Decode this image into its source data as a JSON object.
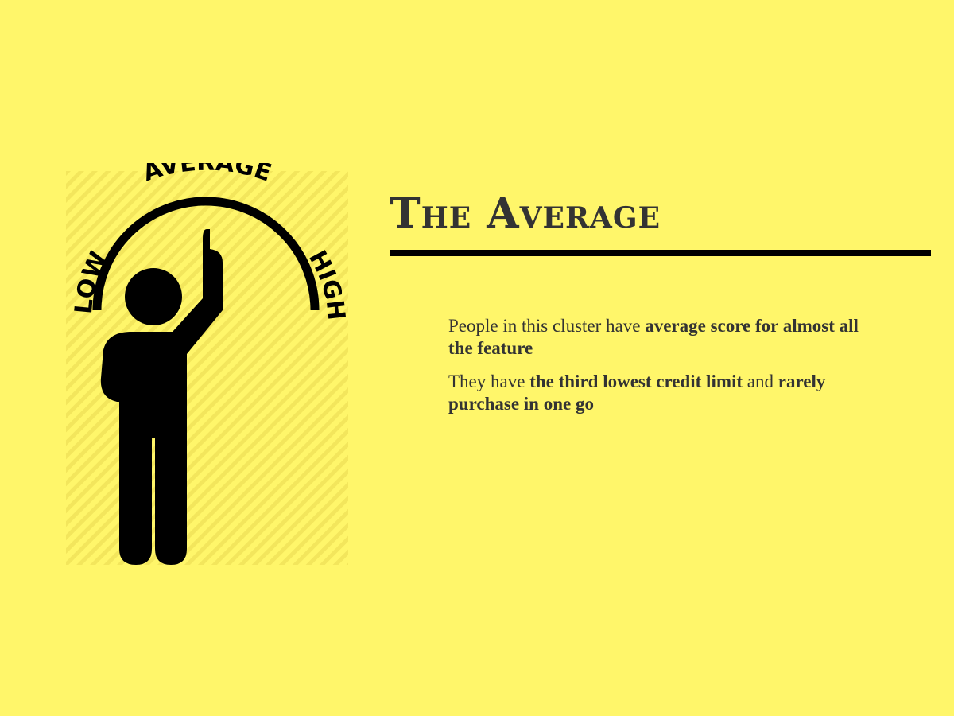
{
  "colors": {
    "background": "#fff66a",
    "text": "#333333",
    "rule": "#000000",
    "icon": "#000000",
    "stripes": "#f3e65c"
  },
  "illustration": {
    "icon_name": "average-person-gauge-icon",
    "gauge_labels": {
      "low": "LOW",
      "average": "AVERAGE",
      "high": "HIGH"
    }
  },
  "title": "The Average",
  "paragraphs": [
    {
      "parts": [
        {
          "text": "People in this cluster have ",
          "bold": false
        },
        {
          "text": "average score for almost all the feature",
          "bold": true
        }
      ]
    },
    {
      "parts": [
        {
          "text": "They have ",
          "bold": false
        },
        {
          "text": "the third lowest credit limit",
          "bold": true
        },
        {
          "text": " and ",
          "bold": false
        },
        {
          "text": "rarely purchase in one go",
          "bold": true
        }
      ]
    }
  ]
}
